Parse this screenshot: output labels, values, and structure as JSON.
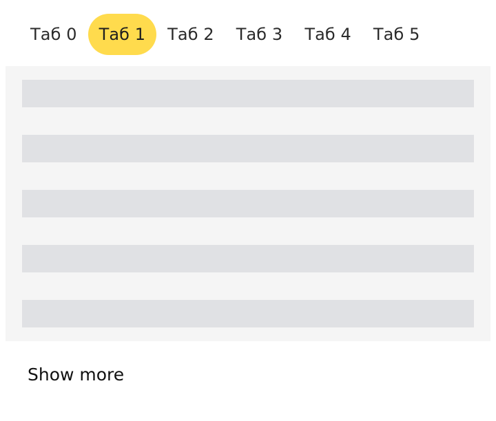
{
  "tabs": [
    {
      "label": "Таб 0",
      "active": false
    },
    {
      "label": "Таб 1",
      "active": true
    },
    {
      "label": "Таб 2",
      "active": false
    },
    {
      "label": "Таб 3",
      "active": false
    },
    {
      "label": "Таб 4",
      "active": false
    },
    {
      "label": "Таб 5",
      "active": false
    }
  ],
  "content": {
    "skeleton_rows": 5
  },
  "show_more_label": "Show more",
  "colors": {
    "active_tab": "#ffdb4d",
    "panel_background": "#f5f5f5",
    "skeleton_row": "#e0e1e4"
  }
}
